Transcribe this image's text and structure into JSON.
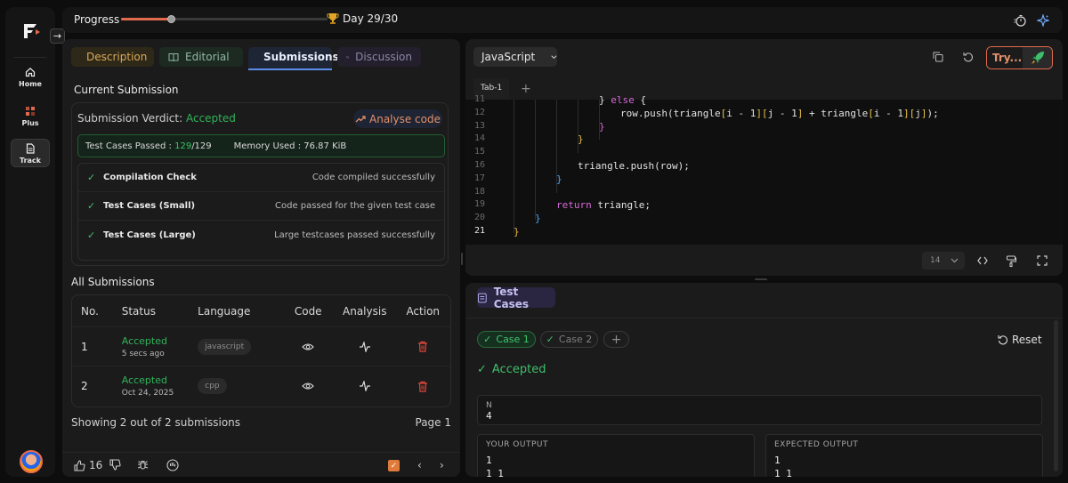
{
  "topbar": {
    "progress_label": "Progress",
    "progress_fraction": 0.24,
    "day_label": "Day 29/30"
  },
  "rail": {
    "items": [
      {
        "label": "Home"
      },
      {
        "label": "Plus"
      },
      {
        "label": "Track"
      }
    ]
  },
  "tabs": [
    {
      "label": "Description"
    },
    {
      "label": "Editorial"
    },
    {
      "label": "Submissions"
    },
    {
      "label": "Discussion"
    }
  ],
  "current": {
    "title": "Current Submission",
    "verdict_prefix": "Submission Verdict: ",
    "verdict": "Accepted",
    "analyse_label": "Analyse code",
    "tc_label": "Test Cases Passed : ",
    "tc_passed": "129",
    "tc_total": "/129",
    "memory": "Memory Used : 76.87 KiB",
    "checks": [
      {
        "name": "Compilation Check",
        "msg": "Code compiled successfully"
      },
      {
        "name": "Test Cases (Small)",
        "msg": "Code passed for the given test case"
      },
      {
        "name": "Test Cases (Large)",
        "msg": "Large testcases passed successfully"
      }
    ]
  },
  "all": {
    "title": "All Submissions",
    "headers": {
      "no": "No.",
      "status": "Status",
      "language": "Language",
      "code": "Code",
      "analysis": "Analysis",
      "action": "Action"
    },
    "rows": [
      {
        "no": "1",
        "status": "Accepted",
        "time": "5 secs ago",
        "lang": "javascript"
      },
      {
        "no": "2",
        "status": "Accepted",
        "time": "Oct 24, 2025",
        "lang": "cpp"
      }
    ],
    "showing": "Showing 2 out of 2 submissions",
    "page": "Page 1"
  },
  "footer": {
    "likes": "16"
  },
  "editor": {
    "language": "JavaScript",
    "try_label": "Try...",
    "file_tab": "Tab-1",
    "font_size": "14",
    "lines": [
      {
        "n": "11",
        "text": "} else {"
      },
      {
        "n": "12",
        "text": "row.push(triangle[i - 1][j - 1] + triangle[i - 1][j]);"
      },
      {
        "n": "13",
        "text": "}"
      },
      {
        "n": "14",
        "text": "}"
      },
      {
        "n": "15",
        "text": ""
      },
      {
        "n": "16",
        "text": "triangle.push(row);"
      },
      {
        "n": "17",
        "text": "}"
      },
      {
        "n": "18",
        "text": ""
      },
      {
        "n": "19",
        "text": "return triangle;"
      },
      {
        "n": "20",
        "text": "}"
      },
      {
        "n": "21",
        "text": "}"
      }
    ]
  },
  "testcases": {
    "tab_label": "Test Cases",
    "case1": "Case 1",
    "case2": "Case 2",
    "reset": "Reset",
    "status": "Accepted",
    "input_label": "N",
    "input_value": "4",
    "your_output_label": "YOUR OUTPUT",
    "your_output": "1\n1 1",
    "expected_label": "EXPECTED OUTPUT",
    "expected": "1\n1 1"
  }
}
